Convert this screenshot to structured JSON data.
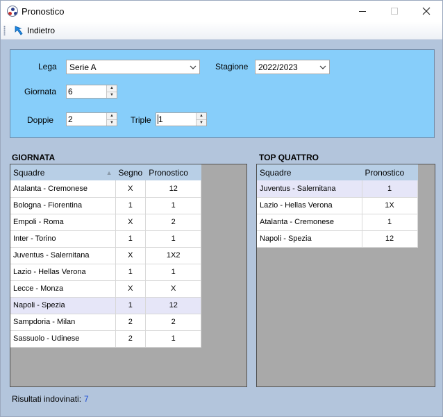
{
  "window": {
    "title": "Pronostico"
  },
  "toolbar": {
    "back_label": "Indietro"
  },
  "filters": {
    "lega_label": "Lega",
    "lega_value": "Serie A",
    "stagione_label": "Stagione",
    "stagione_value": "2022/2023",
    "giornata_label": "Giornata",
    "giornata_value": "6",
    "doppie_label": "Doppie",
    "doppie_value": "2",
    "triple_label": "Triple",
    "triple_value": "1"
  },
  "giornata": {
    "title": "GIORNATA",
    "columns": [
      "Squadre",
      "Segno",
      "Pronostico"
    ],
    "rows": [
      {
        "squadre": "Atalanta - Cremonese",
        "segno": "X",
        "pronostico": "12"
      },
      {
        "squadre": "Bologna - Fiorentina",
        "segno": "1",
        "pronostico": "1"
      },
      {
        "squadre": "Empoli - Roma",
        "segno": "X",
        "pronostico": "2"
      },
      {
        "squadre": "Inter - Torino",
        "segno": "1",
        "pronostico": "1"
      },
      {
        "squadre": "Juventus - Salernitana",
        "segno": "X",
        "pronostico": "1X2"
      },
      {
        "squadre": "Lazio - Hellas Verona",
        "segno": "1",
        "pronostico": "1"
      },
      {
        "squadre": "Lecce - Monza",
        "segno": "X",
        "pronostico": "X"
      },
      {
        "squadre": "Napoli - Spezia",
        "segno": "1",
        "pronostico": "12"
      },
      {
        "squadre": "Sampdoria - Milan",
        "segno": "2",
        "pronostico": "2"
      },
      {
        "squadre": "Sassuolo - Udinese",
        "segno": "2",
        "pronostico": "1"
      }
    ],
    "selected_row": 7
  },
  "top_quattro": {
    "title": "TOP QUATTRO",
    "columns": [
      "Squadre",
      "Pronostico"
    ],
    "rows": [
      {
        "squadre": "Juventus - Salernitana",
        "pronostico": "1"
      },
      {
        "squadre": "Lazio - Hellas Verona",
        "pronostico": "1X"
      },
      {
        "squadre": "Atalanta - Cremonese",
        "pronostico": "1"
      },
      {
        "squadre": "Napoli - Spezia",
        "pronostico": "12"
      }
    ],
    "selected_row": 0
  },
  "footer": {
    "label": "Risultati indovinati:",
    "value": "7"
  },
  "icons": {
    "app": "soccer-ball-icon",
    "back": "back-arrow-icon"
  },
  "colors": {
    "panel_bg": "#87cefa",
    "form_bg": "#b3c5dc",
    "grid_bg": "#a9a9a9",
    "header_bg": "#b8cfe6",
    "selected_row": "#e6e6f8",
    "footer_value": "#1e4fd6"
  }
}
